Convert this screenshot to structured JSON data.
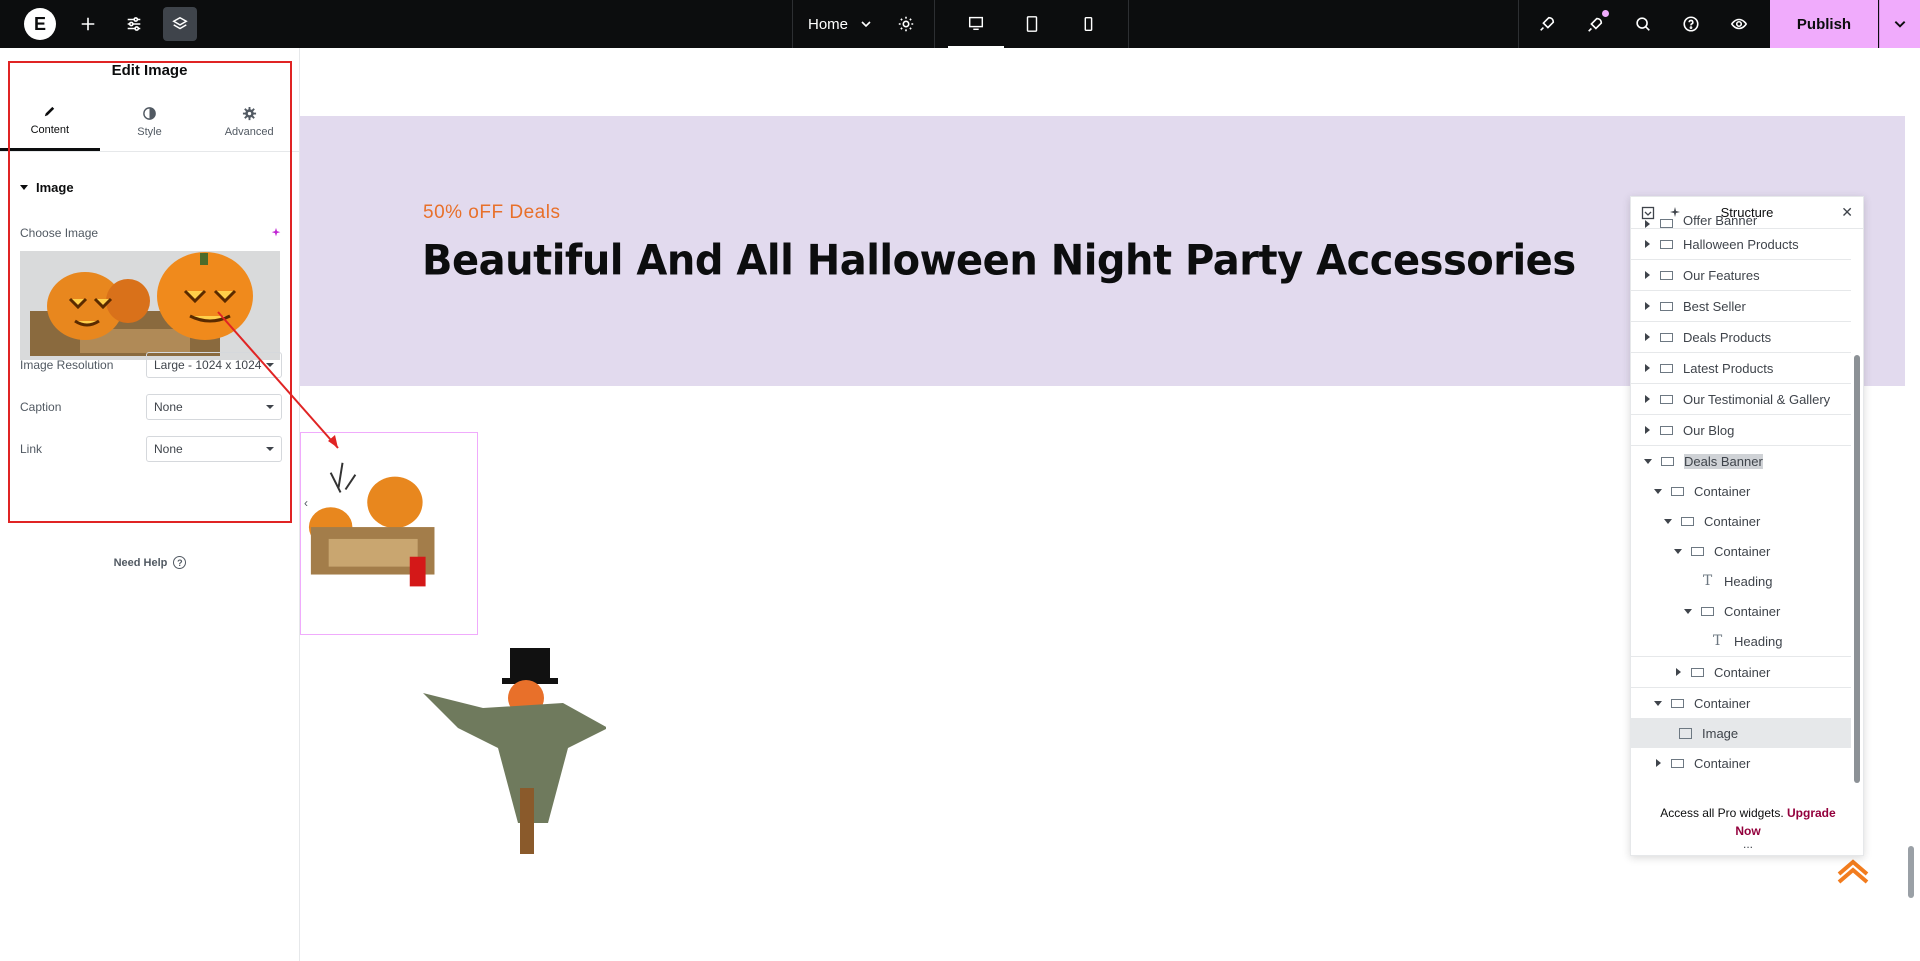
{
  "topbar": {
    "page_selector": "Home",
    "publish_label": "Publish"
  },
  "panel": {
    "title": "Edit Image",
    "tabs": [
      {
        "label": "Content"
      },
      {
        "label": "Style"
      },
      {
        "label": "Advanced"
      }
    ],
    "section_title": "Image",
    "choose_image_label": "Choose Image",
    "controls": [
      {
        "label": "Image Resolution",
        "value": "Large - 1024 x 1024"
      },
      {
        "label": "Caption",
        "value": "None"
      },
      {
        "label": "Link",
        "value": "None"
      }
    ],
    "need_help": "Need Help"
  },
  "canvas": {
    "deal_subtitle": "50% oFF Deals",
    "deal_title": "Beautiful And All Halloween Night Party Accessories",
    "banner_color": "#e2daee"
  },
  "structure": {
    "title": "Structure",
    "items": [
      {
        "label": "Offer Banner"
      },
      {
        "label": "Halloween Products"
      },
      {
        "label": "Our Features"
      },
      {
        "label": "Best Seller"
      },
      {
        "label": "Deals Products"
      },
      {
        "label": "Latest Products"
      },
      {
        "label": "Our Testimonial & Gallery"
      },
      {
        "label": "Our Blog"
      },
      {
        "label": "Deals Banner"
      },
      {
        "label": "Container"
      },
      {
        "label": "Container"
      },
      {
        "label": "Container"
      },
      {
        "label": "Heading"
      },
      {
        "label": "Container"
      },
      {
        "label": "Heading"
      },
      {
        "label": "Container"
      },
      {
        "label": "Container"
      },
      {
        "label": "Image"
      },
      {
        "label": "Container"
      }
    ],
    "upgrade_text": "Access all Pro widgets.",
    "upgrade_link": "Upgrade Now",
    "more": "..."
  },
  "colors": {
    "accent": "#f0abfc",
    "annotation": "#e02424",
    "deal_orange": "#e8702a"
  }
}
